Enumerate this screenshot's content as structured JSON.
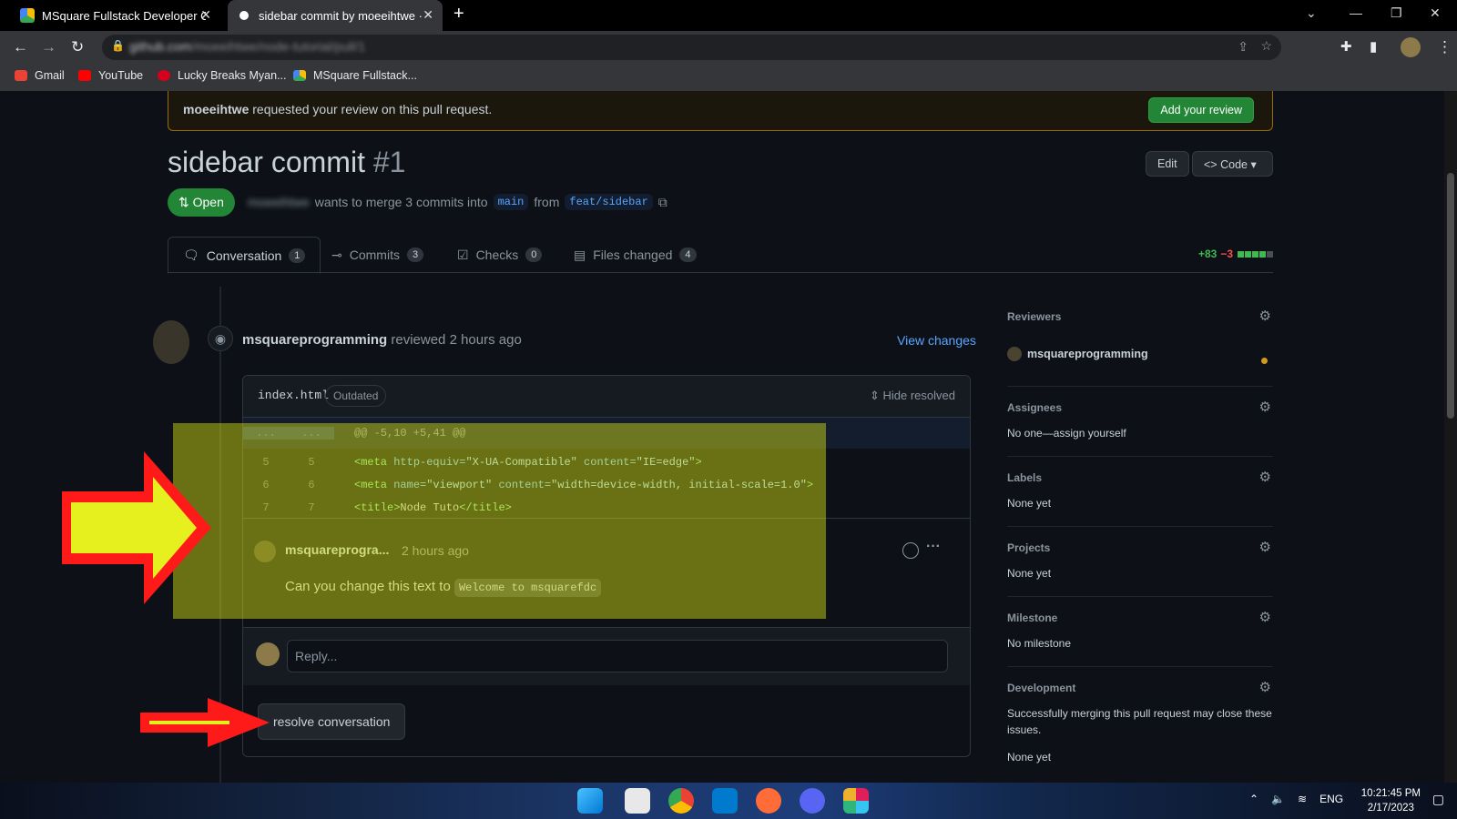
{
  "browser": {
    "tabs": [
      {
        "title": "MSquare Fullstack Developer Co",
        "close": "✕"
      },
      {
        "title": "sidebar commit by moeeihtwe · F",
        "close": "✕"
      }
    ],
    "new_tab": "+",
    "url_host": "github.com",
    "url_path": "/moeeihtwe/node-tutorial/pull/1",
    "bookmarks": [
      "Gmail",
      "YouTube",
      "Lucky Breaks Myan...",
      "MSquare Fullstack..."
    ]
  },
  "banner": {
    "user": "moeeihtwe",
    "text": " requested your review on this pull request.",
    "button": "Add your review"
  },
  "pr": {
    "title": "sidebar commit",
    "number": "#1",
    "edit": "Edit",
    "code": "Code ▾",
    "state": "Open",
    "author": "moeeihtwe",
    "merge_text": "wants to merge 3 commits into",
    "base": "main",
    "from": "from",
    "head": "feat/sidebar"
  },
  "tabs": [
    {
      "label": "Conversation",
      "count": "1"
    },
    {
      "label": "Commits",
      "count": "3"
    },
    {
      "label": "Checks",
      "count": "0"
    },
    {
      "label": "Files changed",
      "count": "4"
    }
  ],
  "diffstat": {
    "add": "+83",
    "del": "−3"
  },
  "review": {
    "author": "msquareprogramming",
    "text": " reviewed 2 hours ago",
    "view_changes": "View changes"
  },
  "thread": {
    "file": "index.html",
    "outdated": "Outdated",
    "hide_resolved": "Hide resolved",
    "hunk": {
      "l": "...",
      "r": "...",
      "text": "@@ -5,10 +5,41 @@"
    },
    "lines": [
      {
        "l": "5",
        "r": "5"
      },
      {
        "l": "6",
        "r": "6"
      },
      {
        "l": "7",
        "r": "7"
      }
    ],
    "code": {
      "line5": {
        "t1": "<meta",
        "a1": " http-equiv=",
        "s1": "\"X-UA-Compatible\"",
        "a2": " content=",
        "s2": "\"IE=edge\"",
        "t2": ">"
      },
      "line6": {
        "t1": "<meta",
        "a1": " name=",
        "s1": "\"viewport\"",
        "a2": " content=",
        "s2": "\"width=device-width, initial-scale=1.0\"",
        "t2": ">"
      },
      "line7": {
        "t1": "<title>",
        "txt": "Node Tuto",
        "t2": "</title>"
      }
    },
    "comment": {
      "author": "msquareprogra...",
      "time": "2 hours ago",
      "more": "···",
      "body": "Can you change this text to ",
      "code": "Welcome to msquarefdc"
    },
    "reply_placeholder": "Reply...",
    "resolve": "resolve conversation"
  },
  "sidebar": {
    "reviewers": {
      "title": "Reviewers",
      "name": "msquareprogramming"
    },
    "assignees": {
      "title": "Assignees",
      "value": "No one—assign yourself"
    },
    "labels": {
      "title": "Labels",
      "value": "None yet"
    },
    "projects": {
      "title": "Projects",
      "value": "None yet"
    },
    "milestone": {
      "title": "Milestone",
      "value": "No milestone"
    },
    "development": {
      "title": "Development",
      "value": "Successfully merging this pull request may close these issues.",
      "value2": "None yet"
    }
  },
  "taskbar": {
    "lang": "ENG",
    "time": "10:21:45 PM",
    "date": "2/17/2023"
  },
  "colors": {
    "highlight": "#dce614",
    "arrow_red": "#ff1a1a",
    "arrow_yellow": "#e6f01e",
    "open_green": "#238636",
    "link_blue": "#58a6ff"
  }
}
